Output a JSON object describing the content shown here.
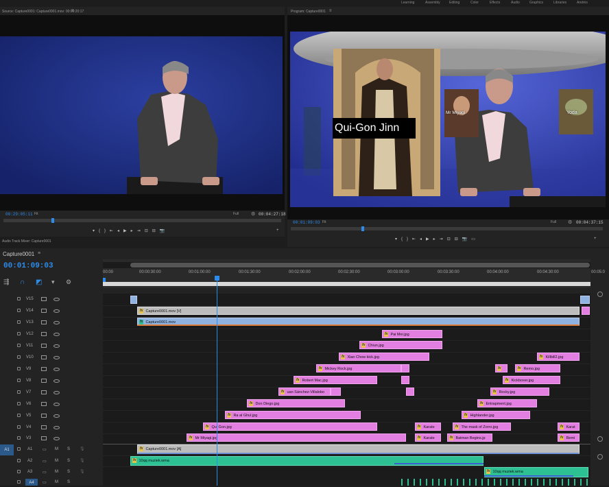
{
  "workspaces": [
    "Learning",
    "Assembly",
    "Editing",
    "Color",
    "Effects",
    "Audio",
    "Graphics",
    "Libraries",
    "Andrés"
  ],
  "source": {
    "tab": "Source: Capture0001: Capture0001.mov: 00:00:20:17",
    "timecode": "00:29:05:11",
    "fit": "Fit",
    "quality": "Full",
    "duration": "00:04:27:18"
  },
  "program": {
    "tab": "Program: Capture0001",
    "timecode": "00:01:09:03",
    "fit": "Fit",
    "quality": "Full",
    "duration": "00:04:37:15",
    "lower_third": "Qui-Gon Jinn",
    "mini_labels": [
      "Mr Miyagi",
      "Yoda"
    ]
  },
  "audio_mixer_tab": "Audio Track Mixer: Capture0001",
  "timeline": {
    "sequence_name": "Capture0001",
    "timecode": "00:01:09:03",
    "ruler": [
      "00:00",
      "00:00:30:00",
      "00:01:00:00",
      "00:01:30:00",
      "00:02:00:00",
      "00:02:30:00",
      "00:03:00:00",
      "00:03:30:00",
      "00:04:00:00",
      "00:04:30:00",
      "00:05:0"
    ],
    "video_tracks": [
      "V15",
      "V14",
      "V13",
      "V12",
      "V11",
      "V10",
      "V9",
      "V8",
      "V7",
      "V6",
      "V5",
      "V4",
      "V3"
    ],
    "audio_tracks": [
      {
        "source": "A1",
        "name": "A1",
        "m": "M",
        "s": "S"
      },
      {
        "source": "",
        "name": "A2",
        "m": "M",
        "s": "S"
      },
      {
        "source": "",
        "name": "A3",
        "m": "M",
        "s": "S"
      },
      {
        "source": "A4",
        "name": "A4",
        "m": "M",
        "s": "S"
      }
    ],
    "clips": {
      "v14": "Capture0001.mov [V]",
      "v13": "Capture0001.mov",
      "v12": "Pai Mei.jpg",
      "v11": "Chiun.jpg",
      "v10a": "Xian Chow kick.jpg",
      "v10b": "Killbill2.jpg",
      "v9a": "Mickey Rock.jpg",
      "v9b": "Remo.jpg",
      "v8a": "Robert Mac.jpg",
      "v8b": "Kickboxer.jpg",
      "v7a": "uan Sánchez-Villalobo",
      "v7b": "Rocky.jpg",
      "v6a": "Don Diego.jpg",
      "v6b": "Entrapment.jpg",
      "v5a": "Ra al Ghul.jpg",
      "v5b": "Highlander.jpg",
      "v4a": "Qui Gon.jpg",
      "v4b": "Karate",
      "v4c": "The mask of Zorro.jpg",
      "v4d": "Karat",
      "v3a": "Mr Miyagi.jpg",
      "v3b": "Karate",
      "v3c": "Batman Begins.jp",
      "v3d": "Remi",
      "a1": "Capture0001.mov [A]",
      "a2": "10qq muziek.wma",
      "a3": "10qq muziek.wma"
    },
    "fx": "fx"
  }
}
